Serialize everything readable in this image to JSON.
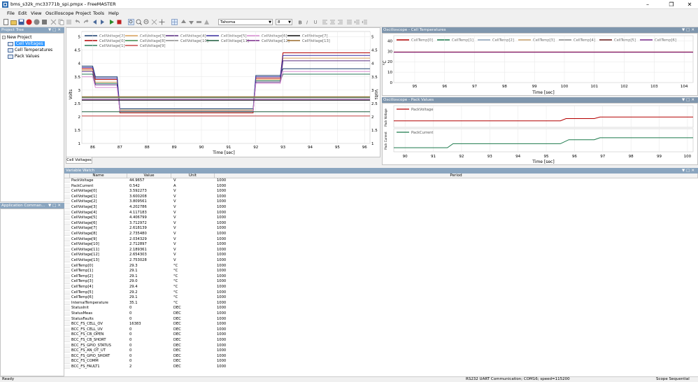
{
  "app": {
    "title": "bms_s32k_mc33771b_spi.pmpx - FreeMASTER",
    "menus": [
      "File",
      "Edit",
      "View",
      "Oscilloscope",
      "Project",
      "Tools",
      "Help"
    ],
    "font_combo": "Tahoma",
    "size_combo": "8"
  },
  "project_tree": {
    "header": "Project Tree",
    "root": "New Project",
    "items": [
      "Cell Voltages",
      "Cell Temperatures",
      "Pack Values"
    ]
  },
  "app_commands": {
    "header": "Application Comman..."
  },
  "cell_voltages": {
    "tab": "Cell Voltages",
    "legend": [
      "CellVoltage[2]",
      "CellVoltage[3]",
      "CellVoltage[4]",
      "CellVoltage[5]",
      "CellVoltage[6]",
      "CellVoltage[7]",
      "CellVoltage[0]",
      "CellVoltage[8]",
      "CellVoltage[10]",
      "CellVoltage[11]",
      "CellVoltage[12]",
      "CellVoltage[13]",
      "CellVoltage[1]",
      "CellVoltage[9]"
    ],
    "legend_colors": [
      "#1a3e6e",
      "#d8a05a",
      "#5a2d82",
      "#3a2fa0",
      "#d68ad0",
      "#111111",
      "#b40000",
      "#3c8a4c",
      "#8c8c8c",
      "#1c5a3c",
      "#7a2a8a",
      "#9a6a2a",
      "#2a7a5a",
      "#c84a4a"
    ],
    "ylabel": "Volts",
    "ylabel_right": "Volts"
  },
  "cell_temps": {
    "header": "Oscilloscope - Cell Temperatures",
    "legend": [
      "CellTemp[0]",
      "CellTemp[1]",
      "CellTemp[2]",
      "CellTemp[3]",
      "CellTemp[4]",
      "CellTemp[5]",
      "CellTemp[6]"
    ],
    "legend_colors": [
      "#b40000",
      "#1c7a4c",
      "#8ca0b8",
      "#c8a06a",
      "#8c8c8c",
      "#6a1a1a",
      "#7a2a8a"
    ],
    "ylabel": "°C"
  },
  "pack_values": {
    "header": "Oscilloscope - Pack Values",
    "legend_top": "PackVoltage",
    "legend_bottom": "PackCurrent",
    "ylabel_top": "Pack Voltage",
    "ylabel_bottom": "Pack Current"
  },
  "chart_data": [
    {
      "type": "line",
      "title": "",
      "xlabel": "Time [sec]",
      "ylabel": "Volts",
      "xlim": [
        85.6,
        96.2
      ],
      "ylim": [
        1.0,
        5.2
      ],
      "x_ticks": [
        86,
        87,
        88,
        89,
        90,
        91,
        92,
        93,
        94,
        95,
        96
      ],
      "y_ticks": [
        1.0,
        1.5,
        2.0,
        2.5,
        3.0,
        3.5,
        4.0,
        4.5,
        5.0
      ],
      "grid": true,
      "series": [
        {
          "name": "CellVoltage[0]",
          "x": [
            85.6,
            86,
            86.1,
            86.9,
            87,
            91.9,
            92,
            92.9,
            93,
            96.2
          ],
          "y": [
            3.8,
            3.8,
            3.4,
            3.4,
            2.15,
            2.15,
            3.45,
            3.45,
            4.4,
            4.4
          ]
        },
        {
          "name": "CellVoltage[1]",
          "x": [
            85.6,
            86,
            86.1,
            86.9,
            87,
            91.9,
            92,
            92.9,
            93,
            96.2
          ],
          "y": [
            3.6,
            3.6,
            3.25,
            3.25,
            2.25,
            2.25,
            3.35,
            3.35,
            3.6,
            3.6
          ]
        },
        {
          "name": "CellVoltage[2]",
          "x": [
            85.6,
            86,
            86.1,
            86.9,
            87,
            91.9,
            92,
            92.9,
            93,
            96.2
          ],
          "y": [
            3.9,
            3.9,
            3.5,
            3.5,
            2.3,
            2.3,
            3.55,
            3.55,
            3.8,
            3.8
          ]
        },
        {
          "name": "CellVoltage[3]",
          "x": [
            85.6,
            86,
            86.1,
            86.9,
            87,
            91.9,
            92,
            92.9,
            93,
            96.2
          ],
          "y": [
            3.75,
            3.75,
            3.3,
            3.3,
            2.25,
            2.25,
            3.4,
            3.4,
            4.2,
            4.2
          ]
        },
        {
          "name": "CellVoltage[4]",
          "x": [
            85.6,
            86,
            86.1,
            86.9,
            87,
            91.9,
            92,
            92.9,
            93,
            96.2
          ],
          "y": [
            3.7,
            3.7,
            3.2,
            3.2,
            2.2,
            2.2,
            3.3,
            3.3,
            4.1,
            4.1
          ]
        },
        {
          "name": "CellVoltage[5]",
          "x": [
            85.6,
            86,
            86.1,
            86.9,
            87,
            91.9,
            92,
            92.9,
            93,
            96.2
          ],
          "y": [
            3.85,
            3.85,
            3.45,
            3.45,
            2.2,
            2.2,
            3.5,
            3.5,
            4.3,
            4.3
          ]
        },
        {
          "name": "CellVoltage[6]",
          "x": [
            85.6,
            86,
            86.1,
            86.9,
            87,
            91.9,
            92,
            92.9,
            93,
            96.2
          ],
          "y": [
            3.5,
            3.5,
            3.1,
            3.1,
            2.2,
            2.2,
            3.25,
            3.25,
            3.7,
            3.7
          ]
        },
        {
          "name": "CellVoltage[7]",
          "x": [
            85.6,
            96.2
          ],
          "y": [
            2.62,
            2.62
          ]
        },
        {
          "name": "CellVoltage[8]",
          "x": [
            85.6,
            96.2
          ],
          "y": [
            2.73,
            2.73
          ]
        },
        {
          "name": "CellVoltage[9]",
          "x": [
            85.6,
            96.2
          ],
          "y": [
            2.03,
            2.03
          ]
        },
        {
          "name": "CellVoltage[10]",
          "x": [
            85.6,
            96.2
          ],
          "y": [
            2.71,
            2.71
          ]
        },
        {
          "name": "CellVoltage[11]",
          "x": [
            85.6,
            96.2
          ],
          "y": [
            2.19,
            2.19
          ]
        },
        {
          "name": "CellVoltage[12]",
          "x": [
            85.6,
            96.2
          ],
          "y": [
            2.65,
            2.65
          ]
        },
        {
          "name": "CellVoltage[13]",
          "x": [
            85.6,
            96.2
          ],
          "y": [
            2.75,
            2.75
          ]
        }
      ]
    },
    {
      "type": "line",
      "title": "",
      "xlabel": "Time [sec]",
      "ylabel": "°C",
      "xlim": [
        94.3,
        104.3
      ],
      "ylim": [
        0,
        45
      ],
      "x_ticks": [
        95,
        96,
        97,
        98,
        99,
        100,
        101,
        102,
        103,
        104
      ],
      "y_ticks": [
        0,
        10,
        20,
        30,
        40
      ],
      "grid": true,
      "series": [
        {
          "name": "CellTemp[0]",
          "x": [
            94.3,
            104.3
          ],
          "y": [
            29.3,
            29.3
          ]
        },
        {
          "name": "CellTemp[6]",
          "x": [
            94.3,
            104.3
          ],
          "y": [
            29.1,
            29.1
          ]
        }
      ]
    },
    {
      "type": "line",
      "title": "",
      "xlabel": "Time [sec]",
      "xlim": [
        89.6,
        100.2
      ],
      "x_ticks": [
        90,
        91,
        92,
        93,
        94,
        95,
        96,
        97,
        98,
        99,
        100
      ],
      "grid": true,
      "series": [
        {
          "name": "PackVoltage",
          "x": [
            89.6,
            95.5,
            95.7,
            96.7,
            96.9,
            100.2
          ],
          "y": [
            40.0,
            40.0,
            40.6,
            40.6,
            41.0,
            41.0
          ]
        },
        {
          "name": "PackCurrent",
          "x": [
            89.6,
            91.5,
            91.7,
            95.5,
            95.8,
            96.7,
            96.9,
            100.2
          ],
          "y": [
            0.0,
            0.0,
            0.2,
            0.2,
            0.4,
            0.4,
            0.5,
            0.5
          ]
        }
      ]
    }
  ],
  "watch": {
    "header": "Variable Watch",
    "columns": [
      "Name",
      "Value",
      "Unit",
      "Period"
    ],
    "rows": [
      [
        "PackVoltage",
        "44.9657",
        "V",
        "1000"
      ],
      [
        "PackCurrent",
        "0.542",
        "A",
        "1000"
      ],
      [
        "CellVoltage[0]",
        "3.592273",
        "V",
        "1000"
      ],
      [
        "CellVoltage[1]",
        "3.600208",
        "V",
        "1000"
      ],
      [
        "CellVoltage[2]",
        "3.809561",
        "V",
        "1000"
      ],
      [
        "CellVoltage[3]",
        "4.202786",
        "V",
        "1000"
      ],
      [
        "CellVoltage[4]",
        "4.117183",
        "V",
        "1000"
      ],
      [
        "CellVoltage[5]",
        "4.406799",
        "V",
        "1000"
      ],
      [
        "CellVoltage[6]",
        "3.712972",
        "V",
        "1000"
      ],
      [
        "CellVoltage[7]",
        "2.618139",
        "V",
        "1000"
      ],
      [
        "CellVoltage[8]",
        "2.735480",
        "V",
        "1000"
      ],
      [
        "CellVoltage[9]",
        "2.034329",
        "V",
        "1000"
      ],
      [
        "CellVoltage[10]",
        "2.712897",
        "V",
        "1000"
      ],
      [
        "CellVoltage[11]",
        "2.189361",
        "V",
        "1000"
      ],
      [
        "CellVoltage[12]",
        "2.654303",
        "V",
        "1000"
      ],
      [
        "CellVoltage[13]",
        "2.753028",
        "V",
        "1000"
      ],
      [
        "CellTemp[0]",
        "29.3",
        "°C",
        "1000"
      ],
      [
        "CellTemp[1]",
        "29.1",
        "°C",
        "1000"
      ],
      [
        "CellTemp[2]",
        "29.1",
        "°C",
        "1000"
      ],
      [
        "CellTemp[3]",
        "29.0",
        "°C",
        "1000"
      ],
      [
        "CellTemp[4]",
        "29.4",
        "°C",
        "1000"
      ],
      [
        "CellTemp[5]",
        "29.2",
        "°C",
        "1000"
      ],
      [
        "CellTemp[6]",
        "29.1",
        "°C",
        "1000"
      ],
      [
        "InternalTemperature",
        "35.1",
        "°C",
        "1000"
      ],
      [
        "StatusInit",
        "0",
        "DEC",
        "1000"
      ],
      [
        "StatusMeas",
        "0",
        "DEC",
        "1000"
      ],
      [
        "StatusFaults",
        "0",
        "DEC",
        "1000"
      ],
      [
        "BCC_FS_CELL_OV",
        "16383",
        "DEC",
        "1000"
      ],
      [
        "BCC_FS_CELL_UV",
        "0",
        "DEC",
        "1000"
      ],
      [
        "BCC_FS_CB_OPEN",
        "0",
        "DEC",
        "1000"
      ],
      [
        "BCC_FS_CB_SHORT",
        "0",
        "DEC",
        "1000"
      ],
      [
        "BCC_FS_GPIO_STATUS",
        "0",
        "DEC",
        "1000"
      ],
      [
        "BCC_FS_AN_OT_UT",
        "0",
        "DEC",
        "1000"
      ],
      [
        "BCC_FS_GPIO_SHORT",
        "0",
        "DEC",
        "1000"
      ],
      [
        "BCC_FS_COMM",
        "0",
        "DEC",
        "1000"
      ],
      [
        "BCC_FS_FAULT1",
        "2",
        "DEC",
        "1000"
      ]
    ]
  },
  "status": {
    "left": "Ready",
    "middle": "RS232 UART Communication; COM16; speed=115200",
    "right": "Scope Sequential"
  }
}
